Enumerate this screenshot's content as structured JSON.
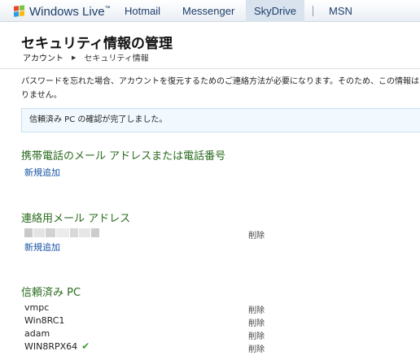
{
  "nav": {
    "brand": "Windows Live",
    "brand_tm": "™",
    "links": [
      "Hotmail",
      "Messenger",
      "SkyDrive",
      "MSN"
    ]
  },
  "header": {
    "title": "セキュリティ情報の管理",
    "breadcrumb": {
      "account": "アカウント",
      "current": "セキュリティ情報"
    }
  },
  "description": {
    "line1": "パスワードを忘れた場合、アカウントを復元するためのご連絡方法が必要になります。そのため、この情報は",
    "line2": "りません。"
  },
  "notice": "信頼済み PC の確認が完了しました。",
  "sections": {
    "phone": {
      "title": "携帯電話のメール アドレスまたは電話番号",
      "add_label": "新規追加"
    },
    "email": {
      "title": "連絡用メール アドレス",
      "delete_label": "削除",
      "add_label": "新規追加"
    },
    "trusted_pc": {
      "title": "信頼済み PC",
      "items": [
        {
          "name": "vmpc",
          "delete_label": "削除"
        },
        {
          "name": "Win8RC1",
          "delete_label": "削除"
        },
        {
          "name": "adam",
          "delete_label": "削除"
        },
        {
          "name": "WIN8RPX64",
          "delete_label": "削除"
        }
      ]
    }
  },
  "colors": {
    "section_title": "#2a6b1e",
    "link": "#1a55a6",
    "notice_bg": "#f2f9fe",
    "check": "#3aa12e"
  },
  "icons": {
    "brand": "windows-flag-icon",
    "breadcrumb_separator": "triangle-right-icon",
    "current_pc": "checkmark-icon"
  }
}
